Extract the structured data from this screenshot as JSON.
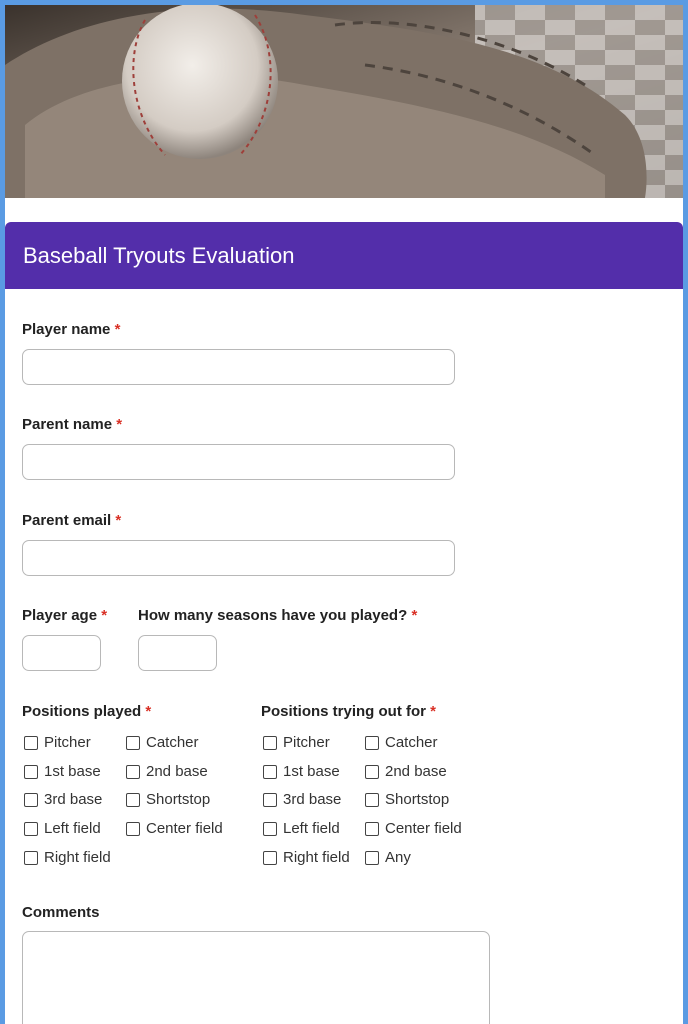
{
  "form": {
    "title": "Baseball Tryouts Evaluation",
    "required_marker": "*",
    "player_name_label": "Player name",
    "parent_name_label": "Parent name",
    "parent_email_label": "Parent email",
    "player_age_label": "Player age",
    "seasons_label": "How many seasons have you played?",
    "positions_played_label": "Positions played",
    "positions_tryout_label": "Positions trying out for",
    "comments_label": "Comments"
  },
  "positions_played": [
    "Pitcher",
    "Catcher",
    "1st base",
    "2nd base",
    "3rd base",
    "Shortstop",
    "Left field",
    "Center field",
    "Right field"
  ],
  "positions_tryout": [
    "Pitcher",
    "Catcher",
    "1st base",
    "2nd base",
    "3rd base",
    "Shortstop",
    "Left field",
    "Center field",
    "Right field",
    "Any"
  ],
  "colors": {
    "header_bg": "#532eaa",
    "frame": "#5a9be3",
    "required": "#d93025"
  }
}
